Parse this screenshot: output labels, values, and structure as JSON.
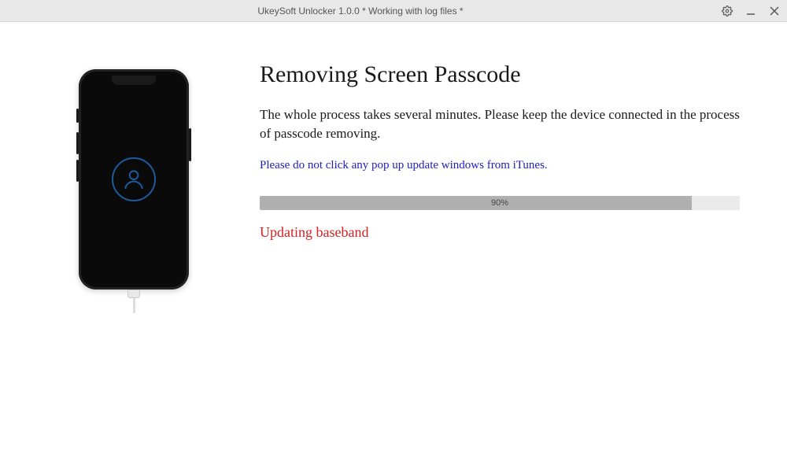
{
  "titlebar": {
    "title": "UkeySoft Unlocker 1.0.0 * Working with log files *"
  },
  "main": {
    "heading": "Removing Screen Passcode",
    "description": "The whole process takes several minutes. Please keep the device connected in the process of passcode removing.",
    "warning": "Please do not click any pop up update windows from iTunes.",
    "progress": {
      "percent": 90,
      "label": "90%"
    },
    "status": "Updating baseband"
  }
}
